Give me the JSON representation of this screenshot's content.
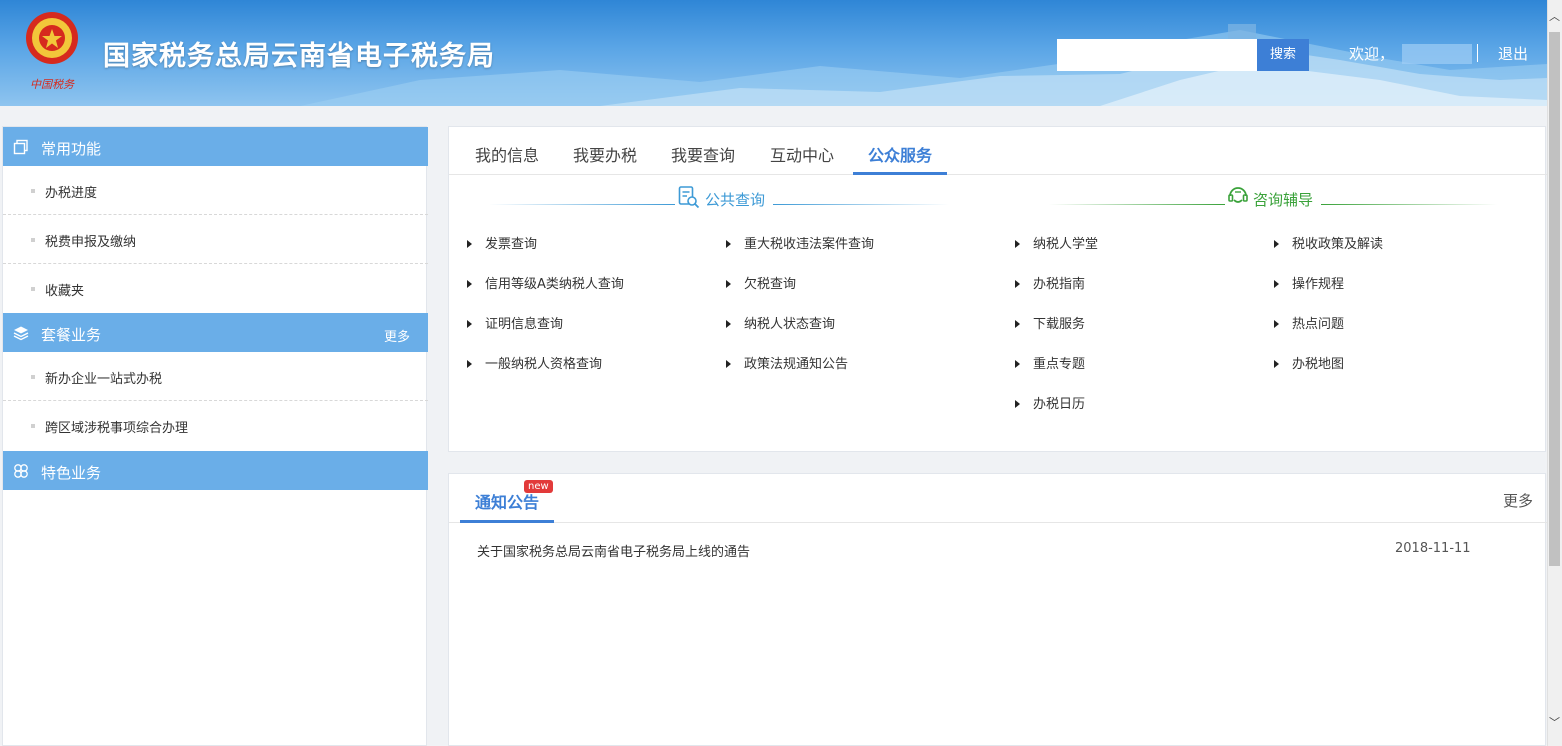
{
  "header": {
    "title": "国家税务总局云南省电子税务局",
    "emblem_caption": "中国税务",
    "search_placeholder": "",
    "search_button": "搜索",
    "welcome": "欢迎，",
    "logout": "退出"
  },
  "sidebar": {
    "sections": [
      {
        "title": "常用功能",
        "icon": "copy-icon",
        "more": ""
      },
      {
        "title": "套餐业务",
        "icon": "layers-icon",
        "more": "更多"
      },
      {
        "title": "特色业务",
        "icon": "flower-icon",
        "more": ""
      }
    ],
    "common_items": [
      "办税进度",
      "税费申报及缴纳",
      "收藏夹"
    ],
    "package_items": [
      "新办企业一站式办税",
      "跨区域涉税事项综合办理"
    ]
  },
  "tabs": [
    "我的信息",
    "我要办税",
    "我要查询",
    "互动中心",
    "公众服务"
  ],
  "active_tab": "公众服务",
  "public_query": {
    "title": "公共查询",
    "col1": [
      "发票查询",
      "信用等级A类纳税人查询",
      "证明信息查询",
      "一般纳税人资格查询"
    ],
    "col2": [
      "重大税收违法案件查询",
      "欠税查询",
      "纳税人状态查询",
      "政策法规通知公告"
    ]
  },
  "consulting": {
    "title": "咨询辅导",
    "col1": [
      "纳税人学堂",
      "办税指南",
      "下载服务",
      "重点专题",
      "办税日历"
    ],
    "col2": [
      "税收政策及解读",
      "操作规程",
      "热点问题",
      "办税地图"
    ]
  },
  "notice": {
    "title": "通知公告",
    "badge": "new",
    "more": "更多",
    "items": [
      {
        "title": "关于国家税务总局云南省电子税务局上线的通告",
        "date": "2018-11-11"
      }
    ]
  },
  "colors": {
    "accent": "#3d7fd6",
    "sidebar_header": "#6aaee8",
    "consult_green": "#3aa23a",
    "query_blue": "#3d9ad6"
  }
}
